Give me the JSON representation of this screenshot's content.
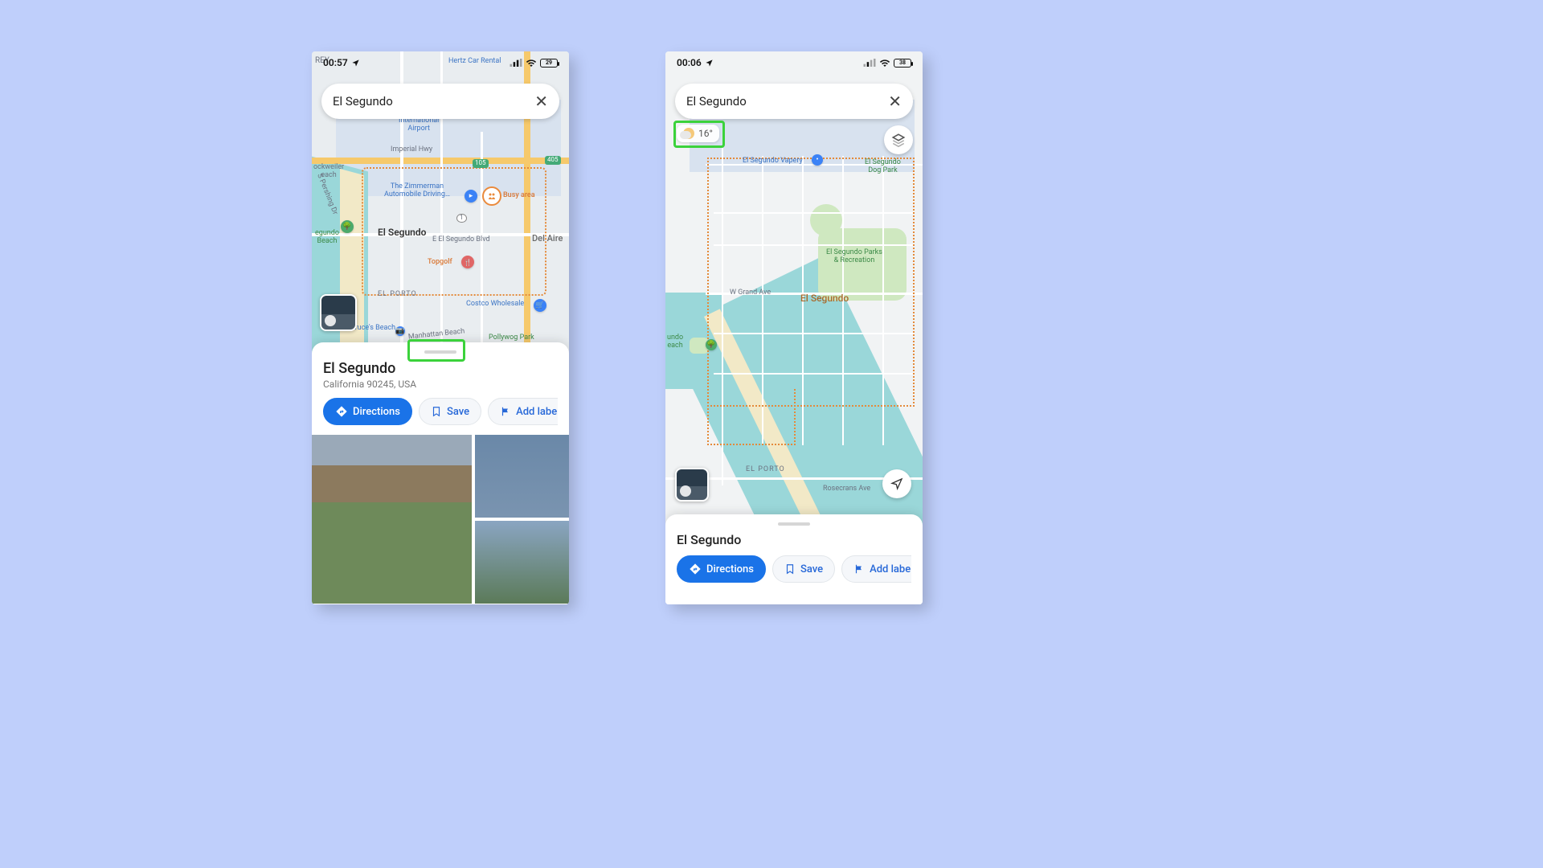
{
  "left": {
    "status": {
      "time": "00:57",
      "battery": "29"
    },
    "search": "El Segundo",
    "sheet": {
      "title": "El Segundo",
      "subtitle": "California 90245, USA",
      "directions": "Directions",
      "save": "Save",
      "addLabel": "Add label"
    },
    "map": {
      "airport": "International\nAirport",
      "zimmer": "The Zimmerman\nAutomobile Driving…",
      "busy": "Busy area",
      "city": "El Segundo",
      "blvd": "E El Segundo Blvd",
      "delaire": "Del Aire",
      "topgolf": "Topgolf",
      "elporto": "EL PORTO",
      "costco": "Costco Wholesale",
      "bruces": "Bruce's Beach",
      "pollywog": "Pollywog Park",
      "hertz": "Hertz Car Rental",
      "hwyI": "Imperial Hwy",
      "pershing": "S Pershing Dr",
      "seg_beach": "egundo\nBeach",
      "rey": "REY",
      "dock": "ockweiler\neach",
      "i105": "105",
      "i405": "405",
      "r1": "1"
    }
  },
  "right": {
    "status": {
      "time": "00:06",
      "battery": "38"
    },
    "search": "El Segundo",
    "weather": "16°",
    "sheet": {
      "title": "El Segundo",
      "directions": "Directions",
      "save": "Save",
      "addLabel": "Add label"
    },
    "map": {
      "city": "El Segundo",
      "parks": "El Segundo Parks\n& Recreation",
      "dogpark": "El Segundo\nDog Park",
      "vapery": "El Segundo Vapery",
      "grand": "W Grand Ave",
      "rosecrans": "Rosecrans Ave",
      "elporto": "EL PORTO",
      "undo_beach": "undo\neach"
    }
  }
}
